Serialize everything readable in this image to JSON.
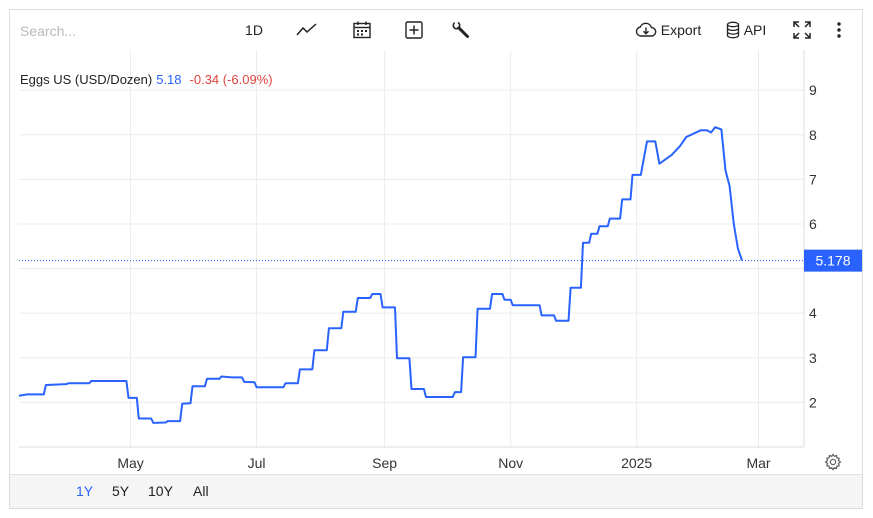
{
  "toolbar": {
    "search_placeholder": "Search...",
    "interval_label": "1D",
    "export_label": "Export",
    "api_label": "API"
  },
  "legend": {
    "name": "Eggs US (USD/Dozen)",
    "value": "5.18",
    "change": "-0.34 (-6.09%)"
  },
  "ranges": [
    "1Y",
    "5Y",
    "10Y",
    "All"
  ],
  "active_range": "1Y",
  "colors": {
    "line": "#2962ff",
    "change_negative": "#e0443e",
    "grid": "#ececec"
  },
  "chart_data": {
    "type": "line",
    "title": "Eggs US (USD/Dozen)",
    "x_axis_ticks": [
      {
        "label": "May",
        "date": "2024-05-01"
      },
      {
        "label": "Jul",
        "date": "2024-07-01"
      },
      {
        "label": "Sep",
        "date": "2024-09-01"
      },
      {
        "label": "Nov",
        "date": "2024-11-01"
      },
      {
        "label": "2025",
        "date": "2025-01-01"
      },
      {
        "label": "Mar",
        "date": "2025-03-01"
      }
    ],
    "y_axis_ticks": [
      2,
      3,
      4,
      5,
      6,
      7,
      8,
      9
    ],
    "y_tick_labels": [
      "2",
      "3",
      "4",
      "",
      "6",
      "7",
      "8",
      "9"
    ],
    "xlim": [
      "2024-03-08",
      "2025-03-23"
    ],
    "ylim": [
      1.0,
      9.9
    ],
    "last_value": 5.178,
    "last_value_label": "5.178",
    "series": [
      {
        "values": [
          [
            "2024-03-08",
            2.15
          ],
          [
            "2024-03-12",
            2.18
          ],
          [
            "2024-03-20",
            2.18
          ],
          [
            "2024-03-21",
            2.39
          ],
          [
            "2024-03-31",
            2.41
          ],
          [
            "2024-04-01",
            2.43
          ],
          [
            "2024-04-11",
            2.43
          ],
          [
            "2024-04-12",
            2.48
          ],
          [
            "2024-04-29",
            2.48
          ],
          [
            "2024-04-30",
            2.1
          ],
          [
            "2024-05-04",
            2.1
          ],
          [
            "2024-05-05",
            1.64
          ],
          [
            "2024-05-11",
            1.64
          ],
          [
            "2024-05-12",
            1.54
          ],
          [
            "2024-05-18",
            1.55
          ],
          [
            "2024-05-19",
            1.58
          ],
          [
            "2024-05-25",
            1.58
          ],
          [
            "2024-05-26",
            1.97
          ],
          [
            "2024-05-30",
            1.98
          ],
          [
            "2024-05-31",
            2.36
          ],
          [
            "2024-06-06",
            2.36
          ],
          [
            "2024-06-07",
            2.53
          ],
          [
            "2024-06-13",
            2.53
          ],
          [
            "2024-06-14",
            2.58
          ],
          [
            "2024-06-19",
            2.56
          ],
          [
            "2024-06-20",
            2.56
          ],
          [
            "2024-06-24",
            2.56
          ],
          [
            "2024-06-25",
            2.46
          ],
          [
            "2024-06-30",
            2.45
          ],
          [
            "2024-07-01",
            2.34
          ],
          [
            "2024-07-14",
            2.34
          ],
          [
            "2024-07-15",
            2.43
          ],
          [
            "2024-07-21",
            2.43
          ],
          [
            "2024-07-22",
            2.74
          ],
          [
            "2024-07-28",
            2.74
          ],
          [
            "2024-07-29",
            3.17
          ],
          [
            "2024-08-04",
            3.17
          ],
          [
            "2024-08-05",
            3.66
          ],
          [
            "2024-08-11",
            3.66
          ],
          [
            "2024-08-12",
            4.03
          ],
          [
            "2024-08-18",
            4.03
          ],
          [
            "2024-08-19",
            4.34
          ],
          [
            "2024-08-25",
            4.34
          ],
          [
            "2024-08-26",
            4.43
          ],
          [
            "2024-08-30",
            4.43
          ],
          [
            "2024-08-31",
            4.13
          ],
          [
            "2024-09-06",
            4.13
          ],
          [
            "2024-09-07",
            2.99
          ],
          [
            "2024-09-13",
            2.99
          ],
          [
            "2024-09-14",
            2.3
          ],
          [
            "2024-09-20",
            2.3
          ],
          [
            "2024-09-21",
            2.12
          ],
          [
            "2024-10-04",
            2.12
          ],
          [
            "2024-10-05",
            2.23
          ],
          [
            "2024-10-08",
            2.23
          ],
          [
            "2024-10-09",
            3.01
          ],
          [
            "2024-10-15",
            3.01
          ],
          [
            "2024-10-16",
            4.1
          ],
          [
            "2024-10-22",
            4.1
          ],
          [
            "2024-10-23",
            4.43
          ],
          [
            "2024-10-28",
            4.43
          ],
          [
            "2024-10-29",
            4.3
          ],
          [
            "2024-11-01",
            4.3
          ],
          [
            "2024-11-02",
            4.18
          ],
          [
            "2024-11-15",
            4.18
          ],
          [
            "2024-11-16",
            3.95
          ],
          [
            "2024-11-22",
            3.95
          ],
          [
            "2024-11-23",
            3.83
          ],
          [
            "2024-11-29",
            3.83
          ],
          [
            "2024-11-30",
            4.57
          ],
          [
            "2024-12-05",
            4.57
          ],
          [
            "2024-12-06",
            5.58
          ],
          [
            "2024-12-09",
            5.58
          ],
          [
            "2024-12-10",
            5.78
          ],
          [
            "2024-12-13",
            5.78
          ],
          [
            "2024-12-14",
            5.95
          ],
          [
            "2024-12-18",
            5.95
          ],
          [
            "2024-12-19",
            6.12
          ],
          [
            "2024-12-24",
            6.12
          ],
          [
            "2024-12-25",
            6.55
          ],
          [
            "2024-12-29",
            6.55
          ],
          [
            "2024-12-30",
            7.1
          ],
          [
            "2025-01-03",
            7.1
          ],
          [
            "2025-01-06",
            7.85
          ],
          [
            "2025-01-10",
            7.85
          ],
          [
            "2025-01-12",
            7.35
          ],
          [
            "2025-01-18",
            7.55
          ],
          [
            "2025-01-22",
            7.75
          ],
          [
            "2025-01-25",
            7.95
          ],
          [
            "2025-02-01",
            8.1
          ],
          [
            "2025-02-04",
            8.1
          ],
          [
            "2025-02-06",
            8.05
          ],
          [
            "2025-02-08",
            8.17
          ],
          [
            "2025-02-11",
            8.12
          ],
          [
            "2025-02-13",
            7.2
          ],
          [
            "2025-02-15",
            6.85
          ],
          [
            "2025-02-17",
            6.0
          ],
          [
            "2025-02-19",
            5.45
          ],
          [
            "2025-02-21",
            5.18
          ]
        ]
      }
    ],
    "grid": true,
    "legend": "top-left"
  }
}
